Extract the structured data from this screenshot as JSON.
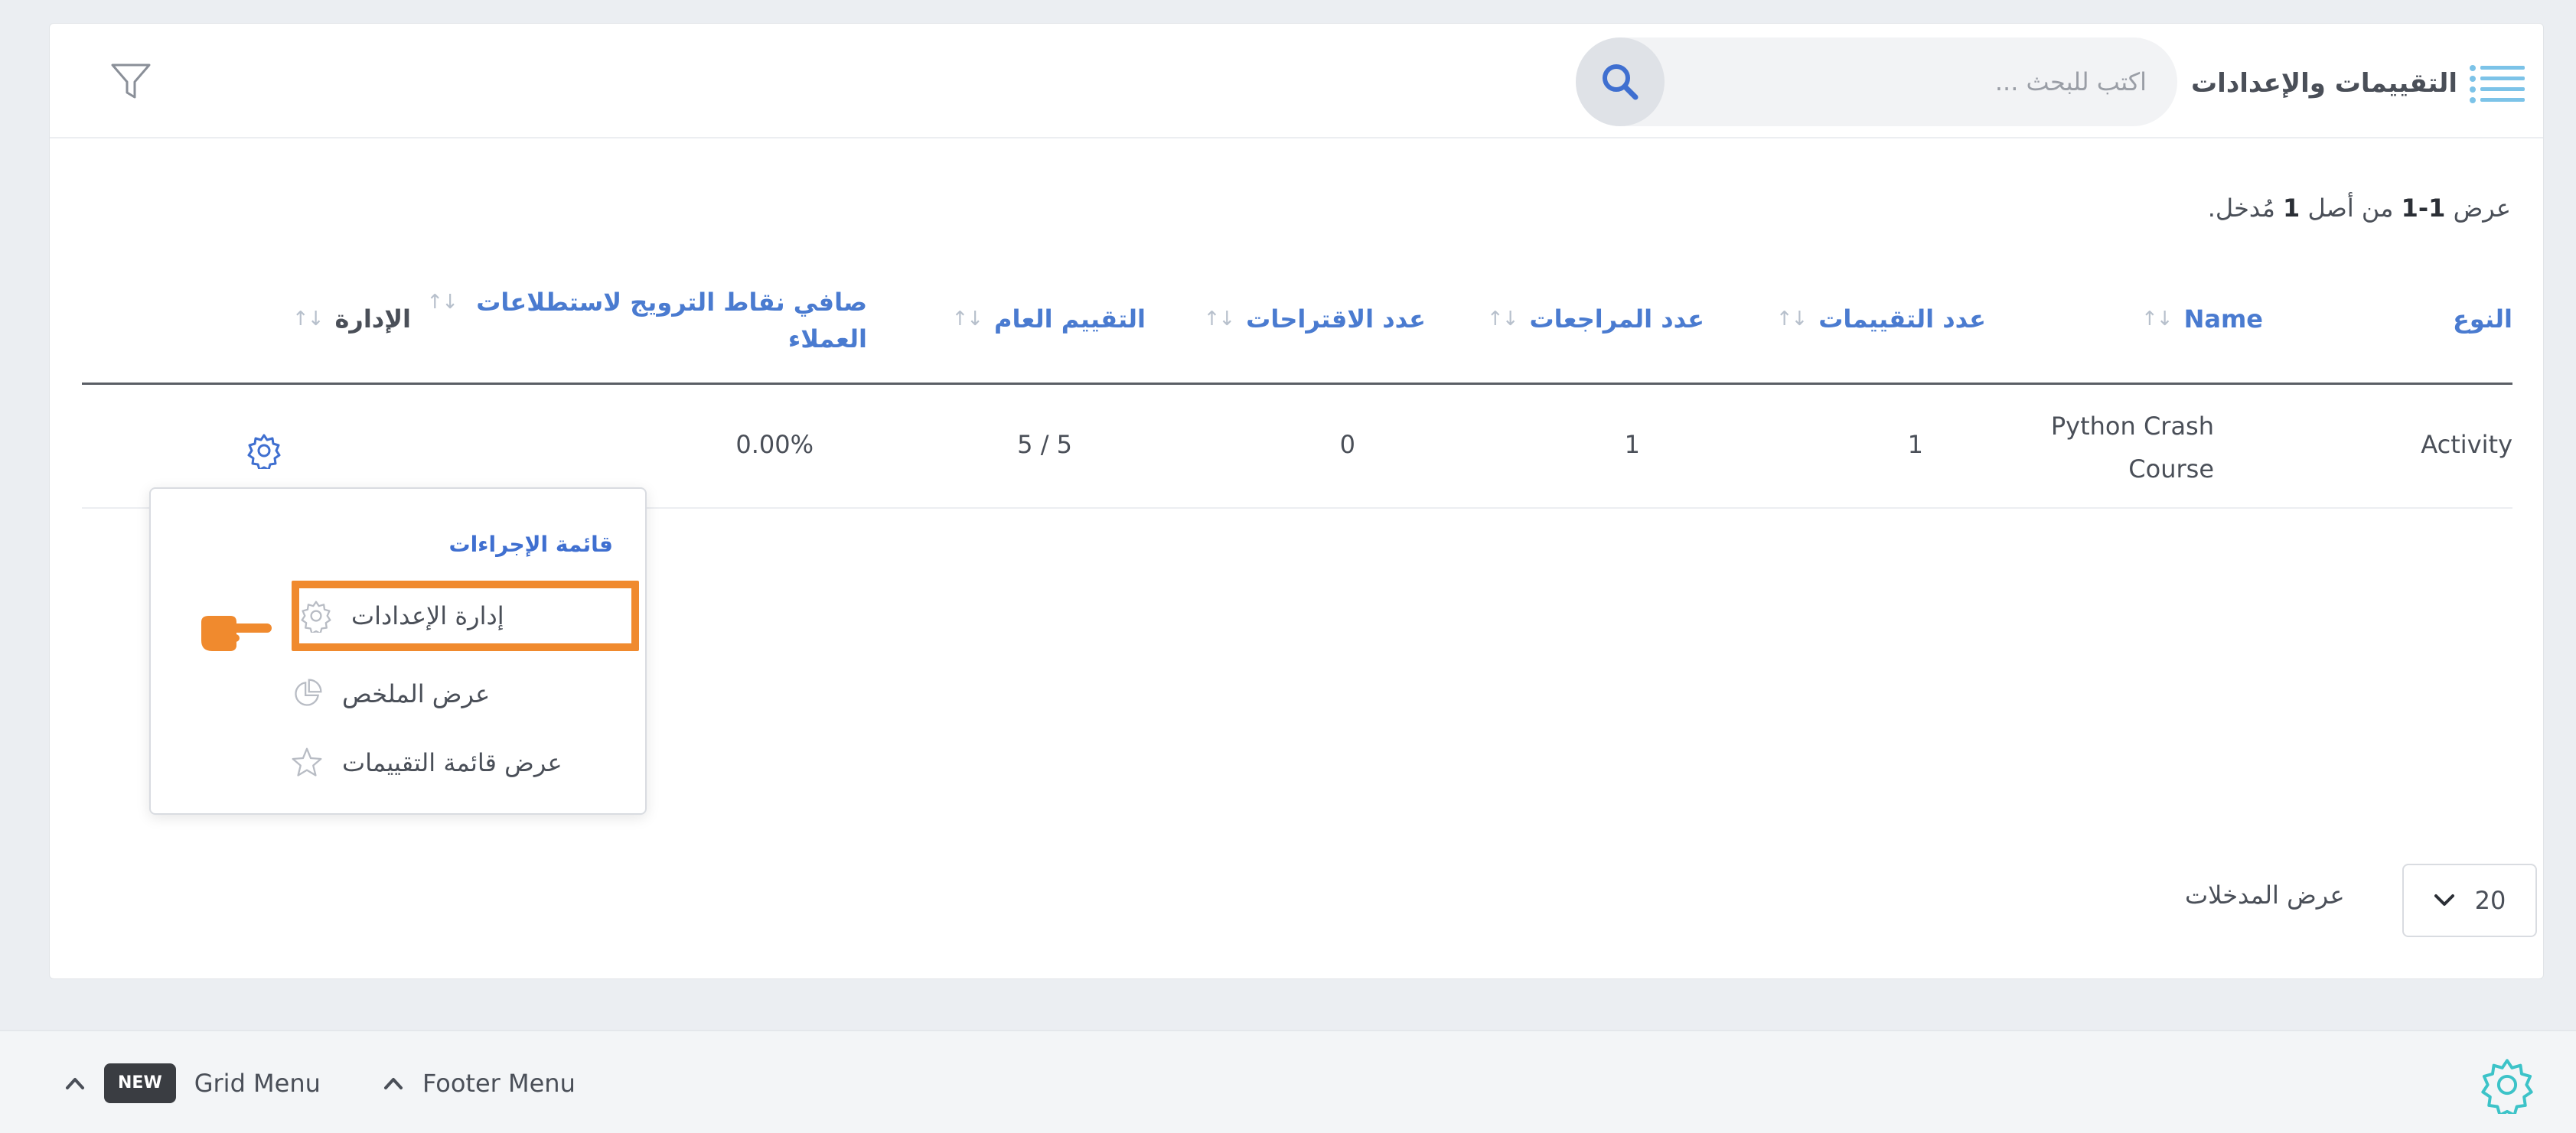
{
  "header": {
    "title": "التقييمات والإعدادات",
    "search_placeholder": "اكتب للبحث ..."
  },
  "summary": {
    "prefix": "عرض",
    "range": "1-1",
    "middle": "من أصل",
    "total": "1",
    "suffix": "مُدخل."
  },
  "table": {
    "columns": [
      "النوع",
      "Name",
      "عدد التقييمات",
      "عدد المراجعات",
      "عدد الاقتراحات",
      "التقييم العام",
      "صافي نقاط الترويج لاستطلاعات العملاء",
      "الإدارة"
    ],
    "sort_glyph": "↓↑",
    "rows": [
      {
        "type": "Activity",
        "name": "Python Crash Course",
        "ratings_count": "1",
        "reviews_count": "1",
        "suggestions_count": "0",
        "overall_rating": "5 / 5",
        "nps": "0.00%"
      }
    ]
  },
  "actions_menu": {
    "title": "قائمة الإجراءات",
    "items": [
      {
        "label": "إدارة الإعدادات",
        "icon": "gear-icon",
        "highlighted": true
      },
      {
        "label": "عرض الملخص",
        "icon": "pie-chart-icon",
        "highlighted": false
      },
      {
        "label": "عرض قائمة التقييمات",
        "icon": "star-icon",
        "highlighted": false
      }
    ]
  },
  "pagination": {
    "page_size": "20",
    "label": "عرض المدخلات"
  },
  "footer": {
    "grid_menu_badge": "NEW",
    "grid_menu_label": "Grid Menu",
    "footer_menu_label": "Footer Menu"
  },
  "colors": {
    "accent_blue": "#4a7bd0",
    "highlight_orange": "#f08a2e",
    "footer_gear": "#3cc3c8"
  }
}
